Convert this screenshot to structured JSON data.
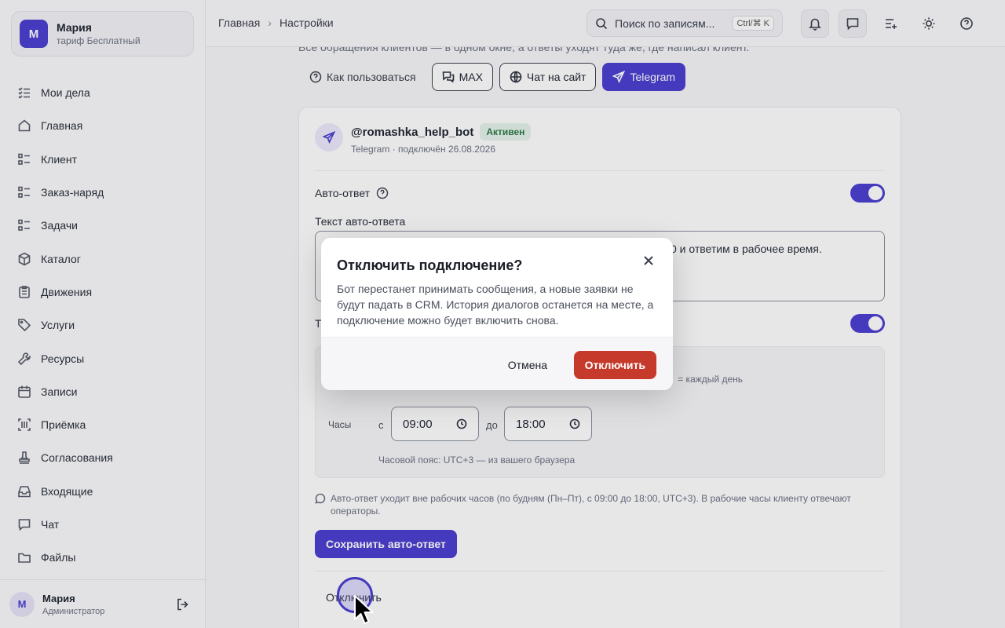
{
  "profile": {
    "avatar_letter": "М",
    "name": "Мария",
    "plan": "тариф Бесплатный"
  },
  "sidebar": {
    "items": [
      {
        "label": "Мои дела",
        "icon": "checklist-icon"
      },
      {
        "label": "Главная",
        "icon": "home-icon"
      },
      {
        "label": "Клиент",
        "icon": "list-icon"
      },
      {
        "label": "Заказ-наряд",
        "icon": "list-icon"
      },
      {
        "label": "Задачи",
        "icon": "list-icon"
      },
      {
        "label": "Каталог",
        "icon": "box-icon"
      },
      {
        "label": "Движения",
        "icon": "clipboard-icon"
      },
      {
        "label": "Услуги",
        "icon": "tag-icon"
      },
      {
        "label": "Ресурсы",
        "icon": "wrench-icon"
      },
      {
        "label": "Записи",
        "icon": "calendar-icon"
      },
      {
        "label": "Приёмка",
        "icon": "barcode-icon"
      },
      {
        "label": "Согласования",
        "icon": "stamp-icon"
      },
      {
        "label": "Входящие",
        "icon": "inbox-icon"
      },
      {
        "label": "Чат",
        "icon": "chat-icon"
      },
      {
        "label": "Файлы",
        "icon": "folder-icon"
      }
    ],
    "footer": {
      "avatar_letter": "М",
      "name": "Мария",
      "role": "Администратор"
    }
  },
  "header": {
    "breadcrumb": [
      "Главная",
      "Настройки"
    ],
    "search_placeholder": "Поиск по записям...",
    "search_shortcut": "Ctrl/⌘ K"
  },
  "main": {
    "intro": "Все обращения клиентов — в одном окне, а ответы уходят туда же, где написал клиент.",
    "help_label": "Как пользоваться",
    "tabs": [
      {
        "label": "MAX",
        "active": false
      },
      {
        "label": "Чат на сайт",
        "active": false
      },
      {
        "label": "Telegram",
        "active": true
      }
    ],
    "bot": {
      "name": "@romashka_help_bot",
      "status": "Активен",
      "subtitle": "Telegram · подключён 26.08.2026"
    },
    "auto_reply_label": "Авто-ответ",
    "auto_reply_enabled": true,
    "auto_reply_text_label": "Текст авто-ответа",
    "auto_reply_text": "0 и ответим в рабочее время.",
    "schedule_enabled": true,
    "schedule_label": "Т",
    "days_hint": "= каждый день",
    "hours_label": "Часы",
    "from_label": "с",
    "to_label": "до",
    "time_from": "09:00",
    "time_to": "18:00",
    "timezone_note": "Часовой пояс: UTC+3 — из вашего браузера",
    "info_note": "Авто-ответ уходит вне рабочих часов (по будням (Пн–Пт), с 09:00 до 18:00, UTC+3). В рабочие часы клиенту отвечают операторы.",
    "save_button": "Сохранить авто-ответ",
    "disconnect_link": "Отключить"
  },
  "modal": {
    "title": "Отключить подключение?",
    "text": "Бот перестанет принимать сообщения, а новые заявки не будут падать в CRM. История диалогов останется на месте, а подключение можно будет включить снова.",
    "cancel": "Отмена",
    "confirm": "Отключить"
  },
  "colors": {
    "accent": "#4b3fd1",
    "danger": "#c53a2b",
    "success_bg": "#e5f3ea",
    "success_text": "#2f7a46"
  }
}
